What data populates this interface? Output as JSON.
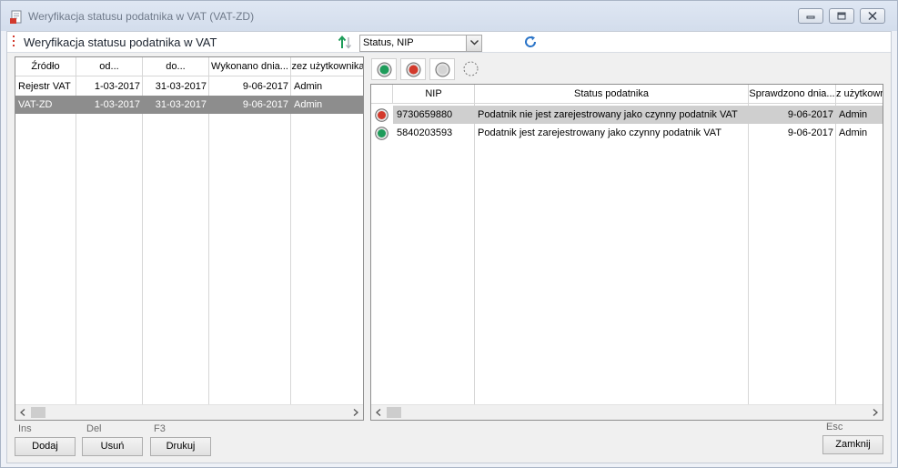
{
  "window": {
    "title": "Weryfikacja statusu podatnika w VAT (VAT-ZD)"
  },
  "header": {
    "title": "Weryfikacja statusu podatnika w VAT",
    "sort_value": "Status, NIP"
  },
  "left_grid": {
    "columns": [
      "Źródło",
      "od...",
      "do...",
      "Wykonano dnia...",
      "zez użytkownika"
    ],
    "rows": [
      {
        "source": "Rejestr VAT",
        "from": "1-03-2017",
        "to": "31-03-2017",
        "done": "9-06-2017",
        "user": "Admin",
        "selected": false
      },
      {
        "source": "VAT-ZD",
        "from": "1-03-2017",
        "to": "31-03-2017",
        "done": "9-06-2017",
        "user": "Admin",
        "selected": true
      }
    ]
  },
  "right_grid": {
    "columns": [
      "NIP",
      "Status podatnika",
      "Sprawdzono dnia...",
      "z użytkowni"
    ],
    "rows": [
      {
        "status": "red",
        "nip": "9730659880",
        "status_text": "Podatnik nie jest zarejestrowany jako czynny podatnik VAT",
        "checked": "9-06-2017",
        "user": "Admin",
        "selected": true
      },
      {
        "status": "green",
        "nip": "5840203593",
        "status_text": "Podatnik jest zarejestrowany jako czynny podatnik VAT",
        "checked": "9-06-2017",
        "user": "Admin",
        "selected": false
      }
    ]
  },
  "colors": {
    "status_green": "#1e9c5a",
    "status_red": "#d33a2c",
    "selected_dark": "#8d8d8d",
    "selected_light": "#cfcfcf"
  },
  "footer": {
    "add": {
      "key": "Ins",
      "label": "Dodaj"
    },
    "delete": {
      "key": "Del",
      "label": "Usuń"
    },
    "print": {
      "key": "F3",
      "label": "Drukuj"
    },
    "close": {
      "key": "Esc",
      "label": "Zamknij"
    }
  }
}
